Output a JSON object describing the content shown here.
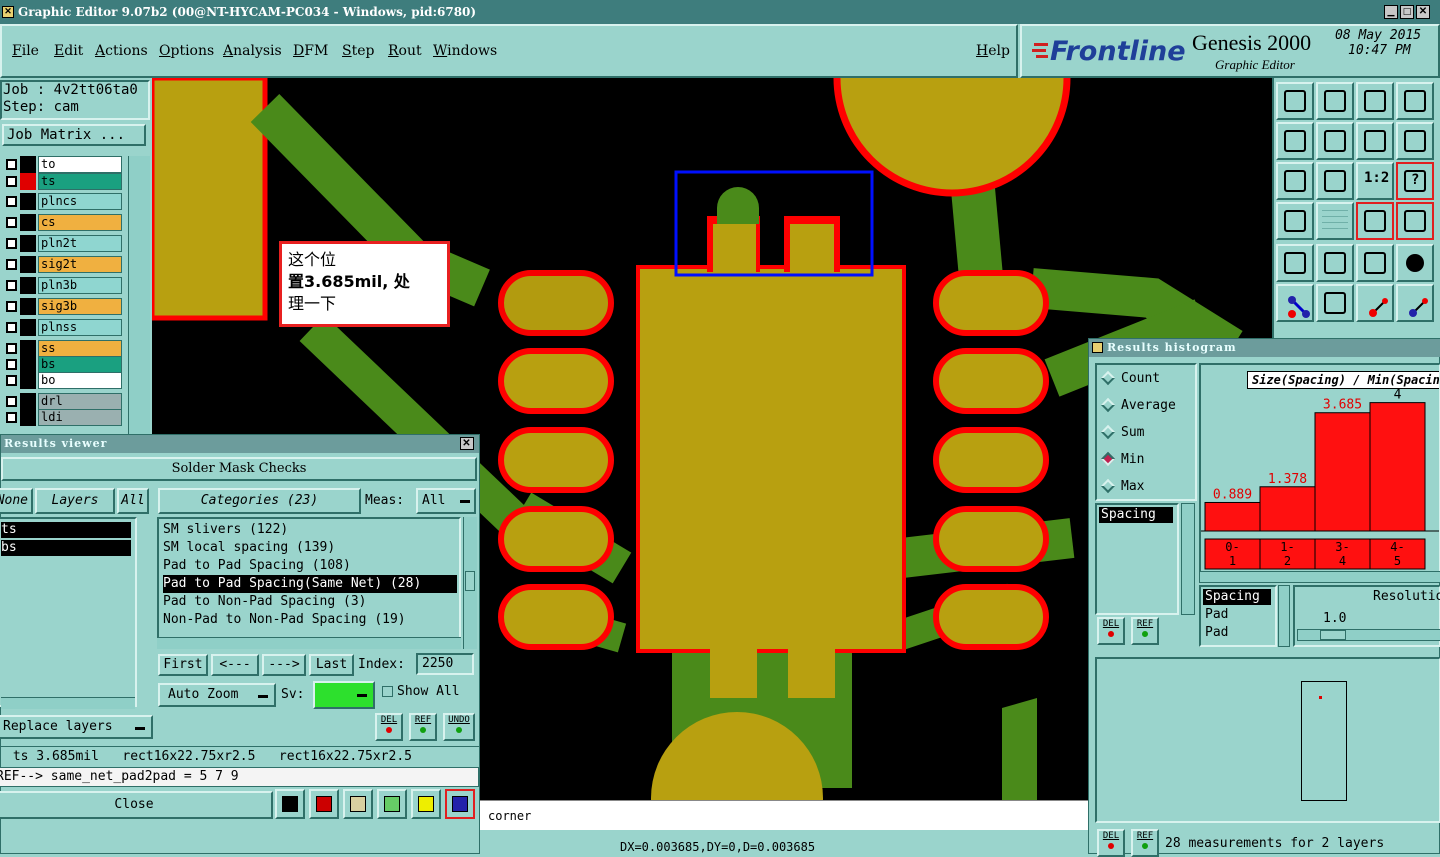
{
  "titlebar": {
    "title": "Graphic Editor 9.07b2 (00@NT-HYCAM-PC034 - Windows, pid:6780)"
  },
  "menu": {
    "file": "File",
    "edit": "Edit",
    "actions": "Actions",
    "options": "Options",
    "analysis": "Analysis",
    "dfm": "DFM",
    "step": "Step",
    "rout": "Rout",
    "windows": "Windows",
    "help": "Help"
  },
  "brand": {
    "logo": "Frontline",
    "product": "Genesis 2000",
    "subtitle": "Graphic Editor",
    "date": "08 May 2015",
    "time": "10:47 PM"
  },
  "job": {
    "job_label": "Job : 4v2tt06ta0",
    "step_label": "Step: cam",
    "matrix_button": "Job Matrix ..."
  },
  "layers": [
    {
      "name": "to",
      "color": "#ffffff",
      "swatch": "#000000"
    },
    {
      "name": "ts",
      "color": "#1aa080",
      "swatch": "#e00000"
    },
    {
      "name": "plncs",
      "color": "#8fd6d0",
      "swatch": "#000000"
    },
    {
      "name": "cs",
      "color": "#f0b040",
      "swatch": "#000000"
    },
    {
      "name": "pln2t",
      "color": "#8fd6d0",
      "swatch": "#000000"
    },
    {
      "name": "sig2t",
      "color": "#f0b040",
      "swatch": "#000000"
    },
    {
      "name": "pln3b",
      "color": "#8fd6d0",
      "swatch": "#000000"
    },
    {
      "name": "sig3b",
      "color": "#f0b040",
      "swatch": "#000000"
    },
    {
      "name": "plnss",
      "color": "#8fd6d0",
      "swatch": "#000000"
    },
    {
      "name": "ss",
      "color": "#f0b040",
      "swatch": "#000000"
    },
    {
      "name": "bs",
      "color": "#1aa080",
      "swatch": "#000000"
    },
    {
      "name": "bo",
      "color": "#ffffff",
      "swatch": "#000000"
    },
    {
      "name": "drl",
      "color": "#9ab0b0",
      "swatch": "#000000"
    },
    {
      "name": "ldi",
      "color": "#9ab0b0",
      "swatch": "#000000"
    }
  ],
  "annotation": {
    "text_line1": "这个位",
    "text_line2": "置3.685mil, 处",
    "text_line3": "理一下"
  },
  "results_viewer": {
    "title": "Results viewer",
    "header": "Solder Mask Checks",
    "none_tab": "None",
    "layers_tab": "Layers",
    "all_tab": "All",
    "categories_label": "Categories (23)",
    "meas_label": "Meas:",
    "meas_value": "All",
    "layer_items": [
      "ts",
      "bs"
    ],
    "categories": [
      "SM slivers (122)",
      "SM local spacing (139)",
      "Pad to Pad Spacing (108)",
      "Pad to Pad Spacing(Same Net) (28)",
      "Pad to Non-Pad Spacing (3)",
      "Non-Pad to Non-Pad Spacing (19)"
    ],
    "first_btn": "First",
    "prev_btn": "<---",
    "next_btn": "--->",
    "last_btn": "Last",
    "index_label": "Index:",
    "index_value": "2250",
    "zoom_btn": "Auto Zoom",
    "sv_label": "Sv:",
    "show_all": "Show All",
    "replace_btn": "Replace layers",
    "del_label": "DEL",
    "ref_label": "REF",
    "undo_label": "UNDO",
    "status1": " ts 3.685mil   rect16x22.75xr2.5   rect16x22.75xr2.5",
    "status2": "REF--> same_net_pad2pad = 5 7 9",
    "close_btn": "Close"
  },
  "histogram": {
    "title": "Results histogram",
    "options": [
      "Count",
      "Average",
      "Sum",
      "Min",
      "Max"
    ],
    "selected": "Min",
    "measure_list": [
      "Spacing"
    ],
    "chart_title": "Size(Spacing) / Min(Spacing)",
    "col_labels": [
      "Spacing",
      "Pad",
      "Pad"
    ],
    "resolution_label": "Resolution",
    "resolution_value": "1.0",
    "summary": "28 measurements for 2 layers",
    "del_label": "DEL",
    "ref_label": "REF"
  },
  "chart_data": {
    "type": "bar",
    "title": "Size(Spacing) / Min(Spacing)",
    "categories": [
      "0-1",
      "1-2",
      "3-4",
      "4-5"
    ],
    "values": [
      0.889,
      1.378,
      3.685,
      4
    ],
    "labels": [
      "0.889",
      "1.378",
      "3.685",
      "4"
    ],
    "ylim": [
      0,
      4.3
    ]
  },
  "status": {
    "coords": "DX=0.003685,DY=0,D=0.003685",
    "hint": "corner"
  }
}
